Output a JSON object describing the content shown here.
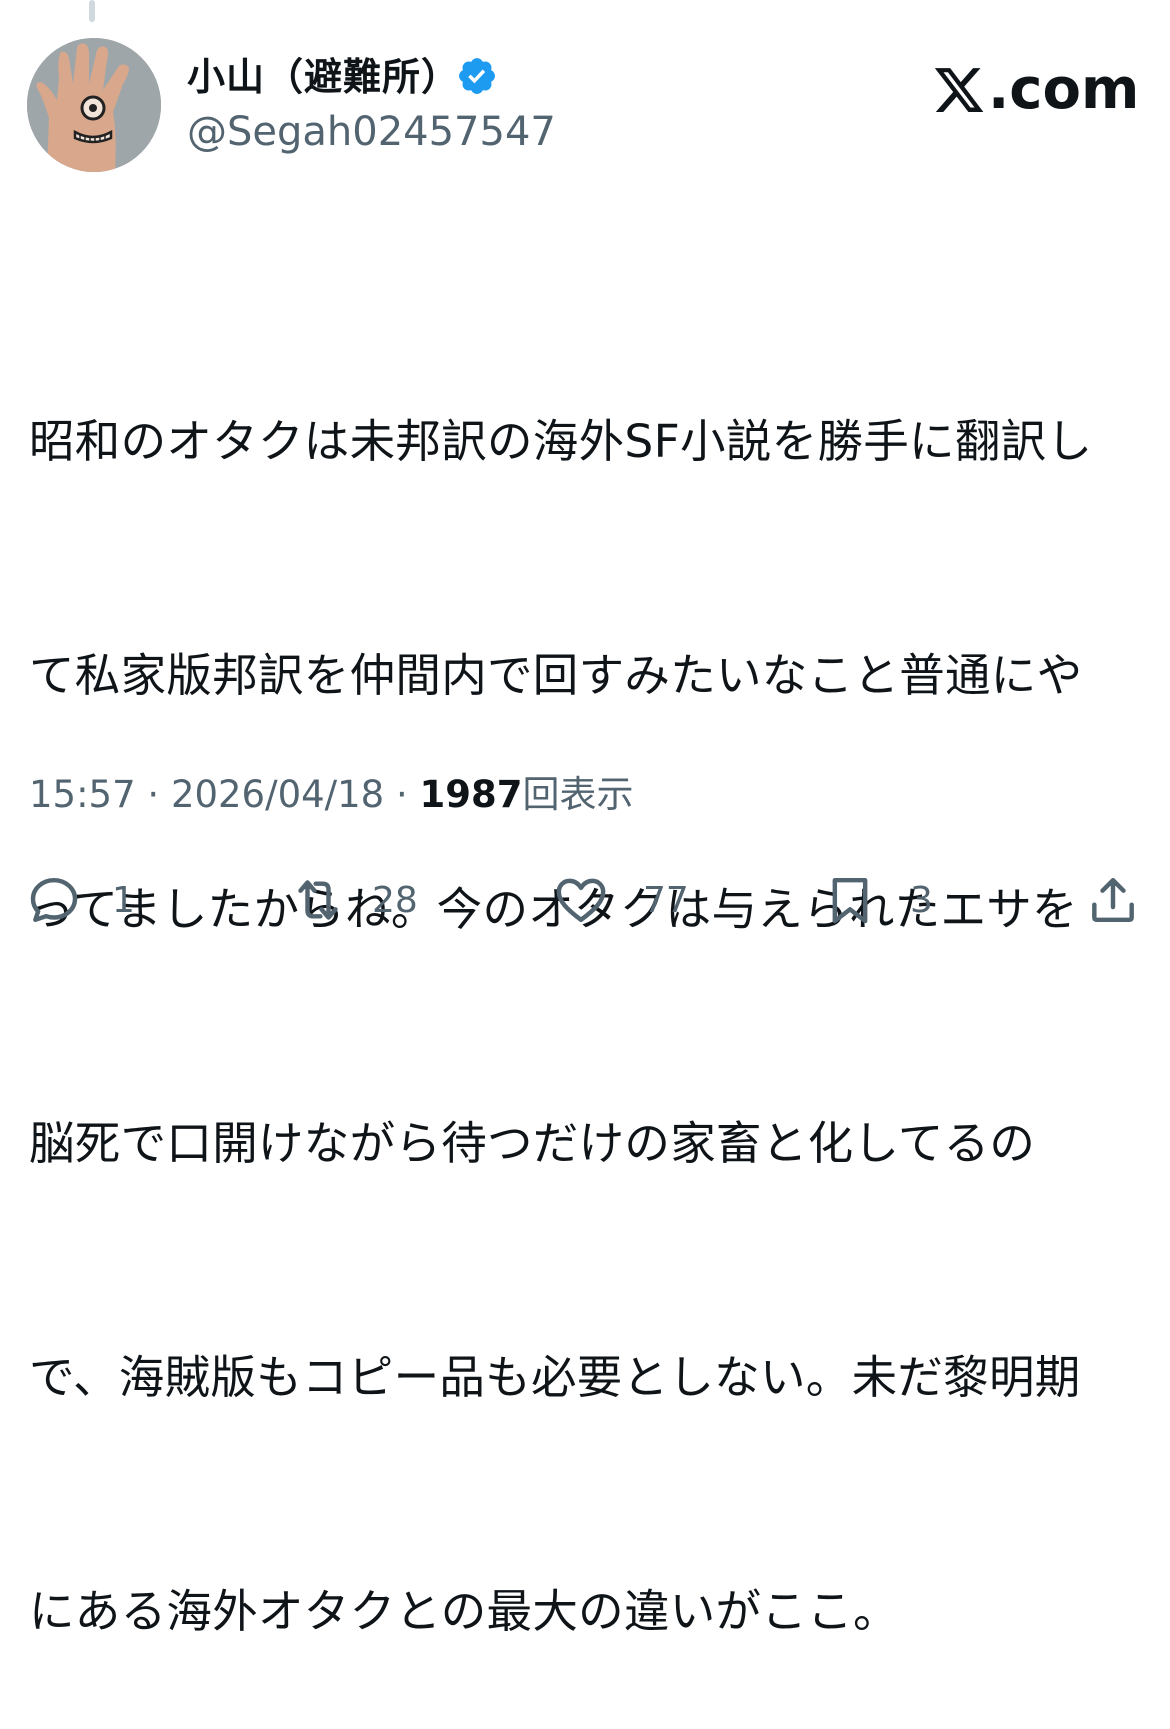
{
  "author": {
    "display_name": "小山（避難所）",
    "handle": "@Segah02457547",
    "verified": true
  },
  "brand": {
    "site": ".com",
    "accent": "#1d9bf0"
  },
  "tweet": {
    "lines": [
      "昭和のオタクは未邦訳の海外SF小説を勝手に翻訳し",
      "て私家版邦訳を仲間内で回すみたいなこと普通にや",
      "ってましたからね。今のオタクは与えられたエサを",
      "脳死で口開けながら待つだけの家畜と化してるの",
      "で、海賊版もコピー品も必要としない。未だ黎明期",
      "にある海外オタクとの最大の違いがここ。"
    ],
    "time": "15:57",
    "date": "2026/04/18",
    "views": "1987",
    "views_label": "回表示"
  },
  "actions": {
    "replies": "1",
    "retweets": "28",
    "likes": "77",
    "bookmarks": "3"
  }
}
